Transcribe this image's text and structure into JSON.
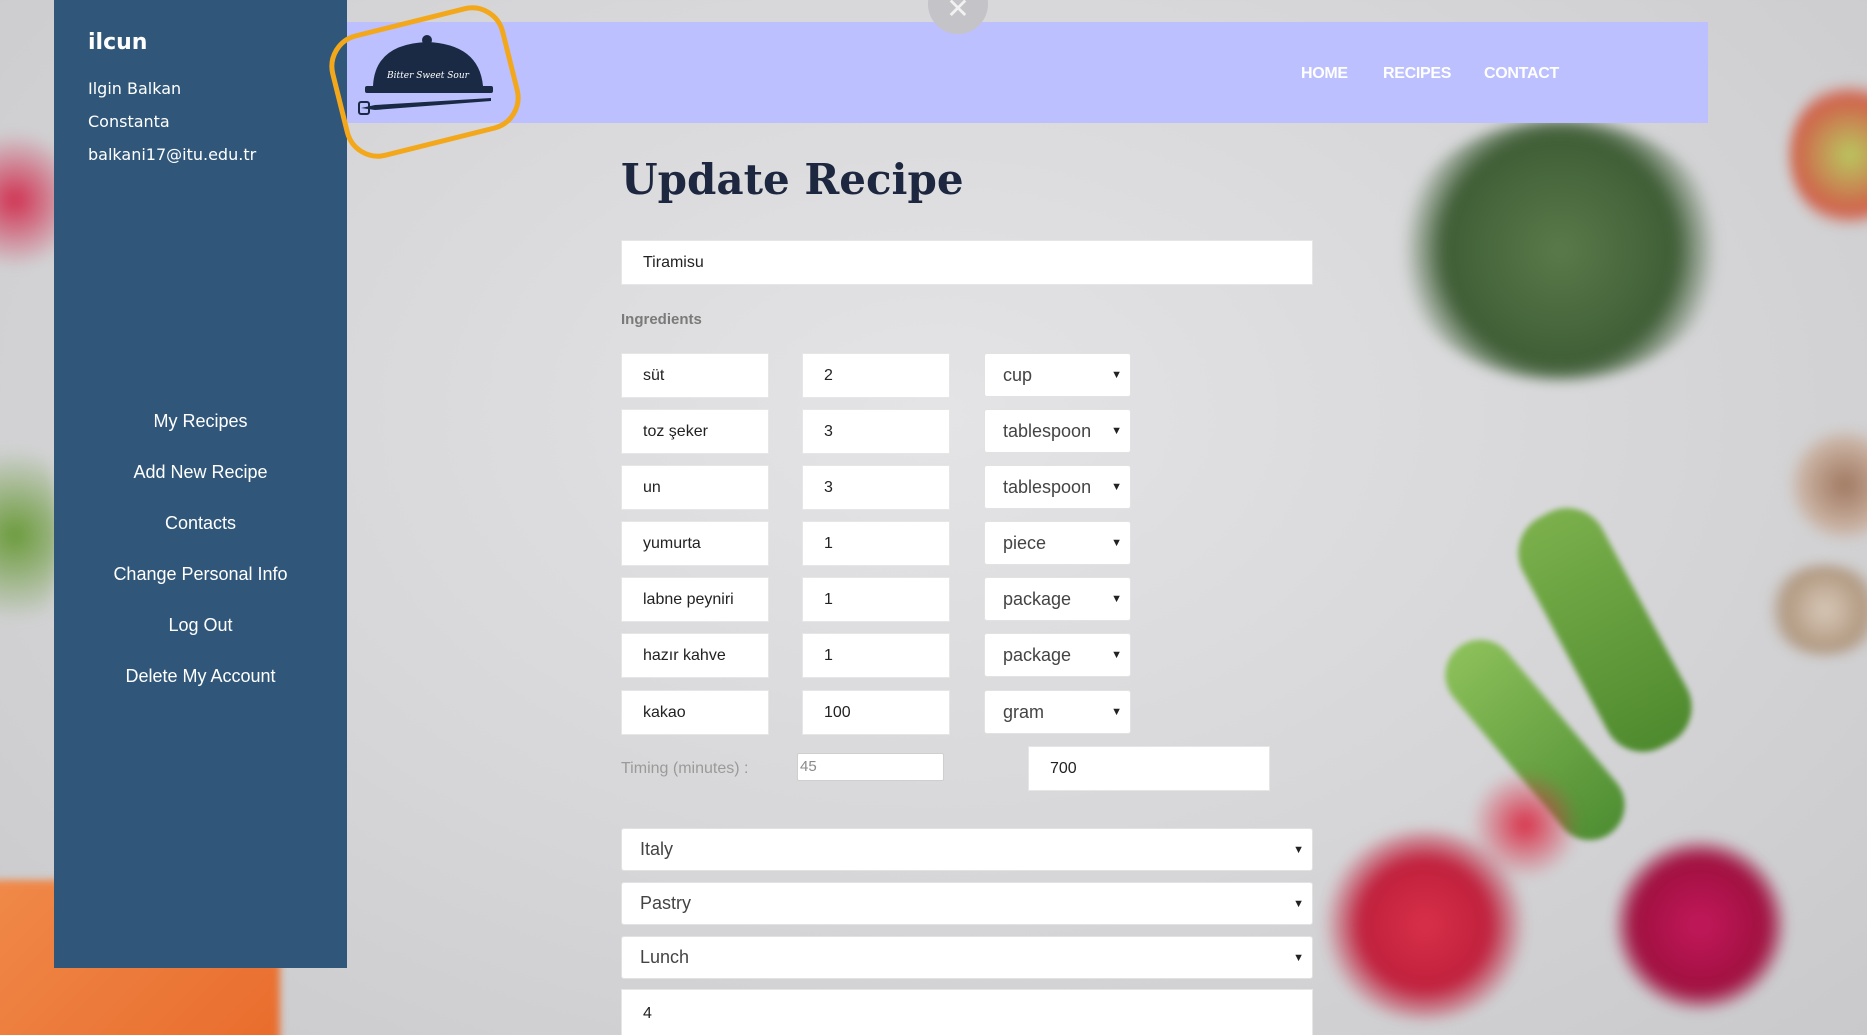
{
  "user": {
    "username": "ilcun",
    "full_name": "Ilgin Balkan",
    "city": "Constanta",
    "email": "balkani17@itu.edu.tr"
  },
  "sidebar": {
    "items": [
      {
        "label": "My Recipes"
      },
      {
        "label": "Add New Recipe"
      },
      {
        "label": "Contacts"
      },
      {
        "label": "Change Personal Info"
      },
      {
        "label": "Log Out"
      },
      {
        "label": "Delete My Account"
      }
    ]
  },
  "header": {
    "logo_text": "Bitter Sweet Sour",
    "nav": {
      "home": "HOME",
      "recipes": "RECIPES",
      "contact": "CONTACT"
    },
    "close_symbol": "✕"
  },
  "form": {
    "title": "Update Recipe",
    "recipe_name": "Tiramisu",
    "ingredients_label": "Ingredients",
    "ingredients": [
      {
        "name": "süt",
        "quantity": "2",
        "unit": "cup"
      },
      {
        "name": "toz şeker",
        "quantity": "3",
        "unit": "tablespoon"
      },
      {
        "name": "un",
        "quantity": "3",
        "unit": "tablespoon"
      },
      {
        "name": "yumurta",
        "quantity": "1",
        "unit": "piece"
      },
      {
        "name": "labne peyniri",
        "quantity": "1",
        "unit": "package"
      },
      {
        "name": "hazır kahve",
        "quantity": "1",
        "unit": "package"
      },
      {
        "name": "kakao",
        "quantity": "100",
        "unit": "gram"
      }
    ],
    "timing_label": "Timing (minutes) :",
    "timing_value": "45",
    "calorie_value": "700",
    "country": "Italy",
    "category": "Pastry",
    "meal": "Lunch",
    "serving": "4"
  },
  "colors": {
    "sidebar_bg": "#30577a",
    "header_bg": "#bcc0fe",
    "logo_frame": "#f3a81c",
    "title_color": "#1d2740"
  }
}
